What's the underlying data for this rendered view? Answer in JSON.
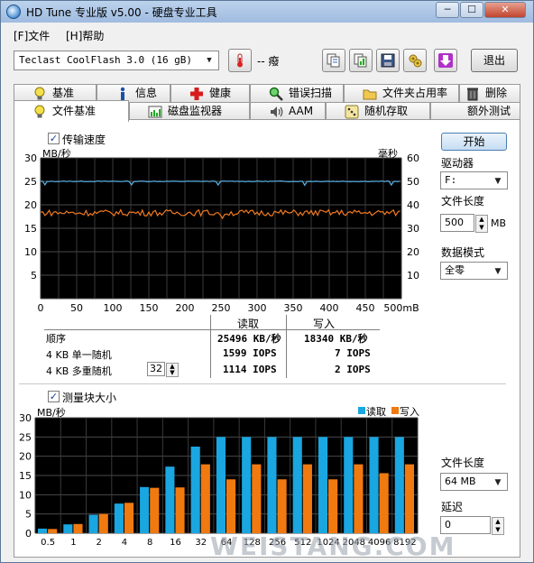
{
  "window": {
    "title": "HD Tune 专业版 v5.00 - 硬盘专业工具",
    "min_label": "─",
    "max_label": "☐",
    "close_label": "✕"
  },
  "menu": {
    "file": "[F]文件",
    "help": "[H]帮助"
  },
  "toolbar": {
    "drive": "Teclast CoolFlash 3.0   (16 gB)",
    "temperature": "-- 癈",
    "exit_label": "退出"
  },
  "tabs_top": [
    {
      "label": "基准",
      "icon": "lightbulb-icon"
    },
    {
      "label": "信息",
      "icon": "info-icon"
    },
    {
      "label": "健康",
      "icon": "plus-cross-icon"
    },
    {
      "label": "错误扫描",
      "icon": "magnifier-icon"
    },
    {
      "label": "文件夹占用率",
      "icon": "folder-icon"
    },
    {
      "label": "删除",
      "icon": "trash-icon"
    }
  ],
  "tabs_bottom": [
    {
      "label": "文件基准",
      "icon": "lightbulb-icon"
    },
    {
      "label": "磁盘监视器",
      "icon": "monitor-chart-icon"
    },
    {
      "label": "AAM",
      "icon": "speaker-icon"
    },
    {
      "label": "随机存取",
      "icon": "dice-icon"
    },
    {
      "label": "额外测试",
      "icon": ""
    }
  ],
  "transfer": {
    "checkbox_label": "传输速度",
    "checked": true,
    "left_unit": "MB/秒",
    "right_unit": "毫秒",
    "y_left_ticks": [
      "30",
      "25",
      "20",
      "15",
      "10",
      "5"
    ],
    "y_right_ticks": [
      "60",
      "50",
      "40",
      "30",
      "20",
      "10"
    ],
    "x_ticks": [
      "0",
      "50",
      "100",
      "150",
      "200",
      "250",
      "300",
      "350",
      "400",
      "450",
      "500mB"
    ]
  },
  "results": {
    "read_header": "读取",
    "write_header": "写入",
    "rows": [
      {
        "label": "顺序",
        "read": "25496 KB/秒",
        "write": "18340 KB/秒"
      },
      {
        "label": "4 KB 单一随机",
        "read": "1599 IOPS",
        "write": "7 IOPS"
      },
      {
        "label": "4 KB 多重随机",
        "read": "1114 IOPS",
        "write": "2 IOPS",
        "queue": "32"
      }
    ]
  },
  "blocksize": {
    "checkbox_label": "测量块大小",
    "checked": true,
    "unit": "MB/秒",
    "legend_read": "读取",
    "legend_write": "写入",
    "read_color": "#1aa6e0",
    "write_color": "#f07a10"
  },
  "chart_data": [
    {
      "type": "line",
      "title": "传输速度",
      "xlabel": "mB",
      "ylabel": "MB/秒",
      "y2label": "毫秒",
      "xlim": [
        0,
        500
      ],
      "ylim": [
        0,
        30
      ],
      "y2lim": [
        0,
        60
      ],
      "grid": true,
      "series": [
        {
          "name": "读取",
          "axis": "left",
          "approx_value": 25.0,
          "color": "#5ab4e8"
        },
        {
          "name": "写入",
          "axis": "left",
          "approx_value": 18.3,
          "color": "#f07a20"
        }
      ]
    },
    {
      "type": "bar",
      "title": "测量块大小",
      "ylabel": "MB/秒",
      "ylim": [
        0,
        30
      ],
      "grid": true,
      "legend": "top-right",
      "categories": [
        "0.5",
        "1",
        "2",
        "4",
        "8",
        "16",
        "32",
        "64",
        "128",
        "256",
        "512",
        "1024",
        "2048",
        "4096",
        "8192"
      ],
      "series": [
        {
          "name": "读取",
          "values": [
            1.2,
            2.3,
            4.8,
            7.7,
            12.0,
            17.3,
            22.5,
            25.0,
            25.0,
            25.0,
            25.0,
            25.0,
            25.0,
            25.0,
            25.0
          ]
        },
        {
          "name": "写入",
          "values": [
            1.1,
            2.4,
            5.0,
            7.9,
            11.8,
            11.9,
            17.9,
            14.0,
            17.9,
            14.0,
            17.9,
            14.0,
            17.9,
            15.6,
            17.9
          ]
        }
      ]
    }
  ],
  "side": {
    "start_label": "开始",
    "drive_label": "驱动器",
    "drive_value": "F:",
    "file_length_label": "文件长度",
    "file_length_value": "500",
    "file_length_unit": "MB",
    "data_mode_label": "数据模式",
    "data_mode_value": "全零",
    "block_file_length_label": "文件长度",
    "block_file_length_value": "64 MB",
    "delay_label": "延迟",
    "delay_value": "0"
  },
  "watermark": "WEISTANG.COM"
}
